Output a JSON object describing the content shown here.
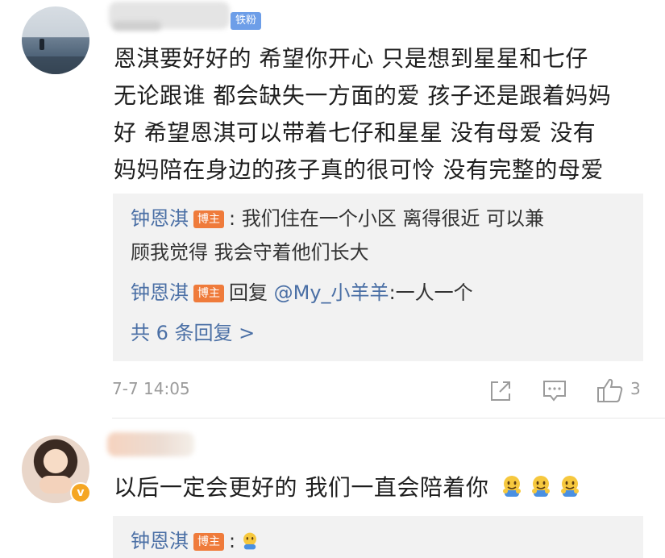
{
  "comment1": {
    "fan_badge": "铁粉",
    "lines": [
      "恩淇要好好的 希望你开心 只是想到星星和七仔",
      "无论跟谁 都会缺失一方面的爱 孩子还是跟着妈妈",
      "好 希望恩淇可以带着七仔和星星 没有母爱 没有",
      "妈妈陪在身边的孩子真的很可怜 没有完整的母爱"
    ],
    "replies": [
      {
        "user": "钟恩淇",
        "badge": "博主",
        "text_line1": ": 我们住在一个小区 离得很近 可以兼",
        "text_line2": "顾我觉得 我会守着他们长大"
      },
      {
        "user": "钟恩淇",
        "badge": "博主",
        "reply_prefix": "回复 ",
        "mention": "@My_小羊羊",
        "text": ":一人一个"
      }
    ],
    "more_replies": "共 6 条回复 >",
    "timestamp": "7-7 14:05",
    "like_count": "3",
    "icons": [
      "share-icon",
      "comment-icon",
      "like-icon"
    ]
  },
  "comment2": {
    "verified_badge": "v",
    "text": "以后一定会更好的 我们一直会陪着你",
    "emoji_icons": [
      "hug-emoji",
      "hug-emoji",
      "hug-emoji"
    ],
    "replies": [
      {
        "user": "钟恩淇",
        "badge": "博主",
        "text": ":"
      }
    ]
  },
  "colors": {
    "username": "#4a6fa5",
    "host_badge": "#ef7b3b",
    "fan_badge": "#6d9ee8",
    "reply_bg": "#f2f2f2",
    "meta": "#9b9b9b"
  }
}
